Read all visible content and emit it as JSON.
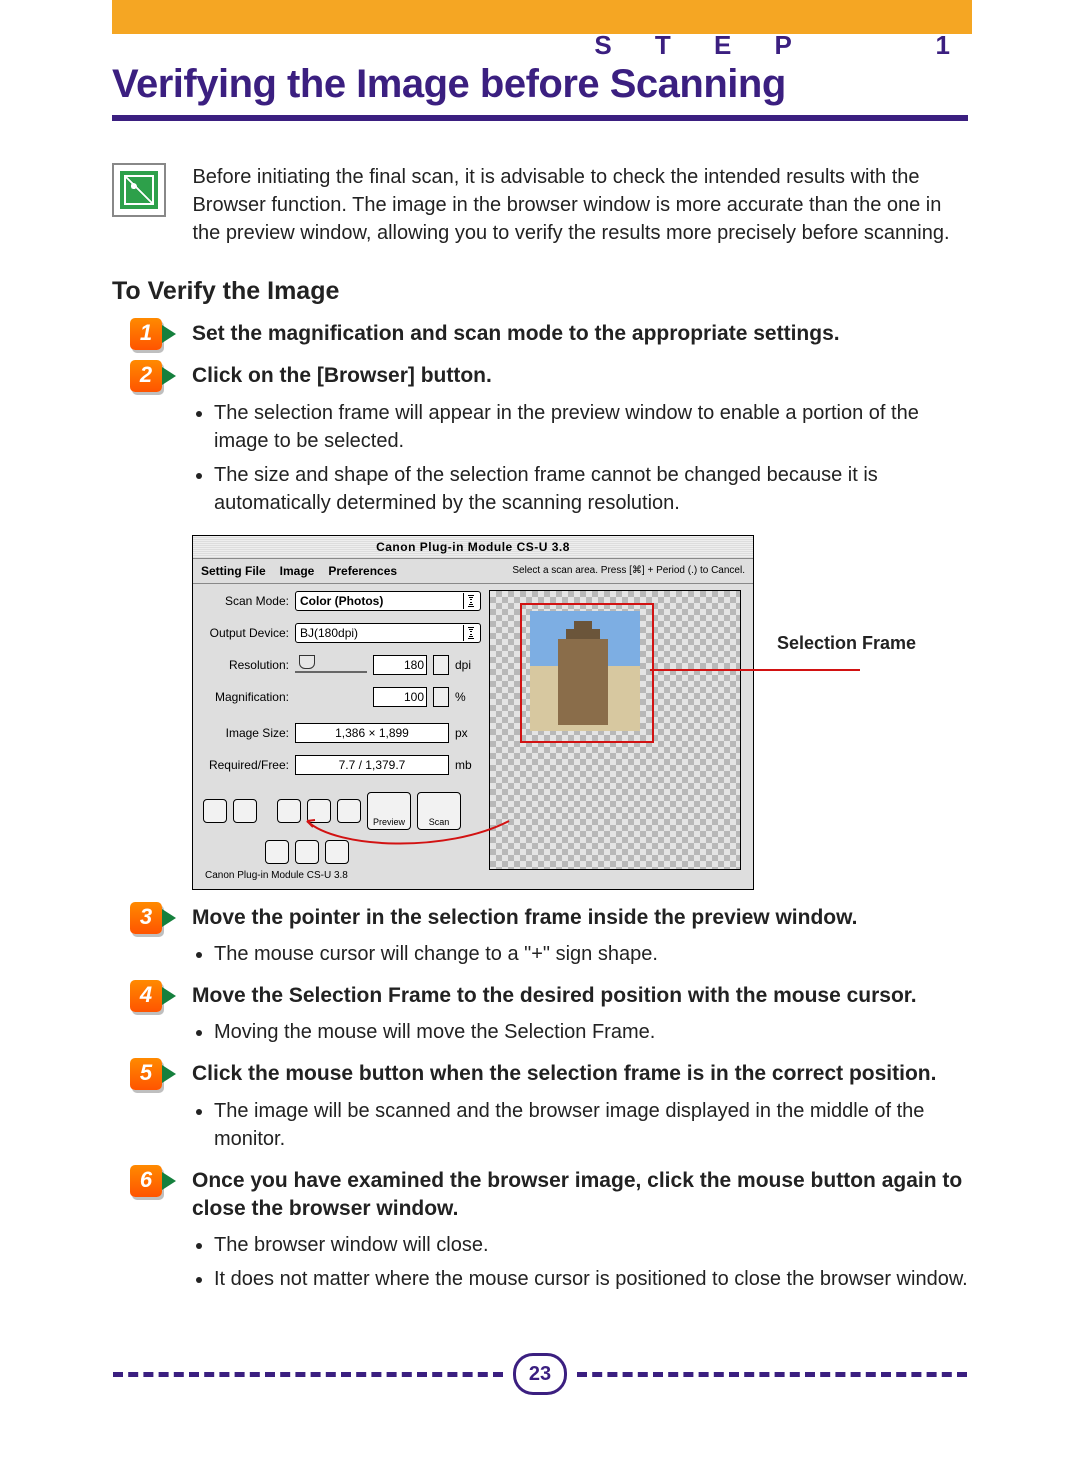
{
  "header": {
    "step_label": "S T E P     1",
    "title": "Verifying the Image before Scanning"
  },
  "intro": "Before initiating the final scan, it is advisable to check the intended results with the Browser function. The image in the browser window is more accurate than the one in the preview window, allowing you to verify the results more precisely before scanning.",
  "section_heading": "To Verify the Image",
  "steps": [
    {
      "num": "1",
      "title": "Set the magnification and scan mode to the appropriate settings.",
      "bullets": []
    },
    {
      "num": "2",
      "title": "Click on the [Browser] button.",
      "bullets": [
        "The selection frame will appear in the preview window to enable a portion of the image to be selected.",
        "The size and shape of the selection frame cannot be changed because it is automatically determined by the scanning resolution."
      ]
    },
    {
      "num": "3",
      "title": "Move the pointer in the selection frame inside the preview window.",
      "bullets": [
        "The mouse cursor will change to a \"+\" sign shape."
      ]
    },
    {
      "num": "4",
      "title": "Move the Selection Frame to the desired position with the mouse cursor.",
      "bullets": [
        "Moving the mouse will move the Selection Frame."
      ]
    },
    {
      "num": "5",
      "title": "Click the mouse button when the selection frame is in the correct position.",
      "bullets": [
        "The image will be scanned and the browser image displayed in the middle of the monitor."
      ]
    },
    {
      "num": "6",
      "title": "Once you have examined the browser image, click the mouse button again to close the browser window.",
      "bullets": [
        "The browser window will close.",
        "It does not matter where the mouse cursor is positioned to close the browser window."
      ]
    }
  ],
  "screenshot": {
    "window_title": "Canon Plug-in Module CS-U 3.8",
    "menus": [
      "Setting File",
      "Image",
      "Preferences"
    ],
    "hint": "Select a scan area. Press [⌘] + Period (.) to Cancel.",
    "fields": {
      "scan_mode_label": "Scan Mode:",
      "scan_mode_value": "Color (Photos)",
      "output_device_label": "Output Device:",
      "output_device_value": "BJ(180dpi)",
      "resolution_label": "Resolution:",
      "resolution_value": "180",
      "resolution_unit": "dpi",
      "magnification_label": "Magnification:",
      "magnification_value": "100",
      "magnification_unit": "%",
      "image_size_label": "Image Size:",
      "image_size_value": "1,386 × 1,899",
      "image_size_unit": "px",
      "required_free_label": "Required/Free:",
      "required_free_value": "7.7 / 1,379.7",
      "required_free_unit": "mb"
    },
    "buttons": {
      "preview": "Preview",
      "scan": "Scan"
    },
    "status_line": "Canon Plug-in Module CS-U 3.8",
    "callout": "Selection Frame"
  },
  "page_number": "23"
}
